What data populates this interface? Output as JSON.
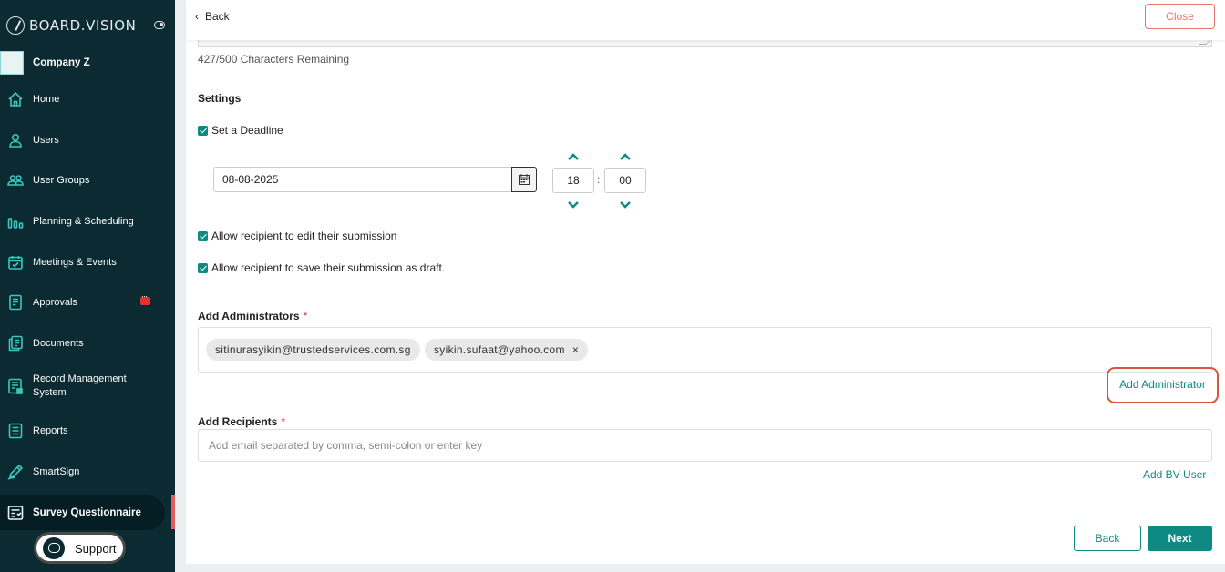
{
  "app": {
    "brand": "BOARD.VISION",
    "company": "Company Z"
  },
  "sidebar": {
    "items": [
      {
        "label": "Home",
        "icon": "home-icon"
      },
      {
        "label": "Users",
        "icon": "user-icon"
      },
      {
        "label": "User Groups",
        "icon": "user-group-icon"
      },
      {
        "label": "Planning & Scheduling",
        "icon": "chart-bars-icon"
      },
      {
        "label": "Meetings & Events",
        "icon": "calendar-check-icon"
      },
      {
        "label": "Approvals",
        "icon": "approval-doc-icon",
        "badge": true
      },
      {
        "label": "Documents",
        "icon": "documents-icon"
      },
      {
        "label": "Record Management System",
        "icon": "record-icon"
      },
      {
        "label": "Reports",
        "icon": "report-icon"
      },
      {
        "label": "SmartSign",
        "icon": "pen-icon"
      },
      {
        "label": "Survey Questionnaire",
        "icon": "survey-icon",
        "active": true
      }
    ],
    "support_label": "Support"
  },
  "topbar": {
    "back_label": "Back",
    "close_label": "Close"
  },
  "form": {
    "char_count": "427/500 Characters Remaining",
    "settings_title": "Settings",
    "deadline_label": "Set a Deadline",
    "deadline_date": "08-08-2025",
    "deadline_hour": "18",
    "deadline_minute": "00",
    "time_separator": ":",
    "allow_edit_label": "Allow recipient to edit their submission",
    "allow_draft_label": "Allow recipient to save their submission as draft.",
    "administrators_title": "Add Administrators",
    "required_mark": "*",
    "administrators": [
      {
        "email": "sitinurasyikin@trustedservices.com.sg",
        "removable": false
      },
      {
        "email": "syikin.sufaat@yahoo.com",
        "removable": true,
        "remove_glyph": "×"
      }
    ],
    "add_administrator_label": "Add Administrator",
    "recipients_title": "Add Recipients",
    "recipients_placeholder": "Add email separated by comma, semi-colon or enter key",
    "add_bv_user_label": "Add BV User"
  },
  "footer": {
    "back_label": "Back",
    "next_label": "Next"
  },
  "colors": {
    "sidebar_bg": "#0c2a31",
    "accent": "#0e8a83",
    "danger": "#e0322f",
    "highlight_ring": "#d9553e"
  }
}
